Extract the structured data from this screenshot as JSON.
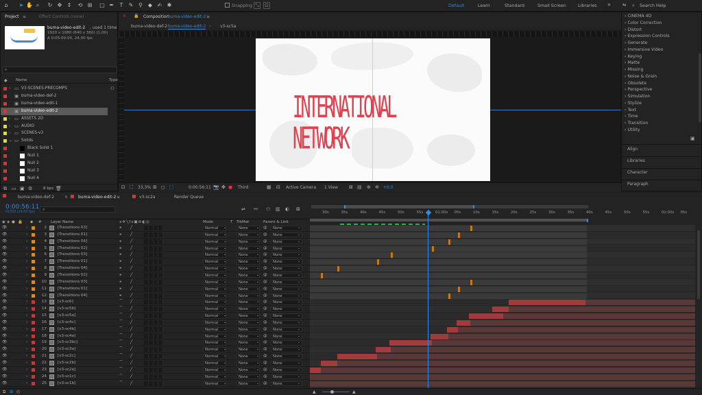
{
  "toolbar": {
    "snapping": "Snapping",
    "workspaces": [
      "Default",
      "Learn",
      "Standard",
      "Small Screen",
      "Libraries"
    ],
    "search": "Search Help",
    "overflow": "»"
  },
  "project": {
    "tab": "Project",
    "effects_tab": "Effect Controls (none)",
    "thumb_title": "buma-video-edit-2",
    "thumb_used": ", used 1 time",
    "thumb_res": "1920 x 1080 (640 x 360) (1,00)",
    "thumb_dur": "Δ 0:05:00:00, 24,00 fps",
    "col_name": "Name",
    "col_type": "Type",
    "items": [
      {
        "name": "V3-SCENES-PRECOMPS",
        "color": "#d33",
        "folder": true
      },
      {
        "name": "buma-video-def-2",
        "color": "#d33",
        "folder": false
      },
      {
        "name": "buma-video-edit-1",
        "color": "#d33",
        "folder": false
      },
      {
        "name": "buma-video-edit-2",
        "color": "#d33",
        "folder": false,
        "selected": true
      },
      {
        "name": "ASSETS 2D",
        "color": "#dd3",
        "folder": true
      },
      {
        "name": "AUDIO",
        "color": "#dd3",
        "folder": true
      },
      {
        "name": "SCENES-v3",
        "color": "#dd3",
        "folder": true
      },
      {
        "name": "Solids",
        "color": "#dd3",
        "folder": true,
        "open": true
      },
      {
        "name": "Black Solid 1",
        "color": "#d33",
        "folder": false,
        "swatch": "#000"
      },
      {
        "name": "Null 1",
        "color": "#d33",
        "folder": false,
        "swatch": "#fff"
      },
      {
        "name": "Null 2",
        "color": "#d33",
        "folder": false,
        "swatch": "#fff"
      },
      {
        "name": "Null 3",
        "color": "#d33",
        "folder": false,
        "swatch": "#fff"
      },
      {
        "name": "Null 4",
        "color": "#d33",
        "folder": false,
        "swatch": "#fff"
      }
    ],
    "bpc": "8 bpc"
  },
  "composition": {
    "label": "Composition",
    "name": "buma-video-edit-2",
    "tabs": [
      "buma-video-def-2",
      "buma-video-edit-2",
      "v3-sc5a"
    ],
    "headline": "INTERNATIONAL NETWORK",
    "zoom": "33,3%",
    "timecode": "0:00:56:11",
    "quality": "Third",
    "camera": "Active Camera",
    "views": "1 View",
    "exposure": "+0,0"
  },
  "effects": {
    "items": [
      "CINEMA 4D",
      "Color Correction",
      "Distort",
      "Expression Controls",
      "Generate",
      "Immersive Video",
      "Keying",
      "Matte",
      "Missing",
      "Noise & Grain",
      "Obsolete",
      "Perspective",
      "Simulation",
      "Stylize",
      "Text",
      "Time",
      "Transition",
      "Utility"
    ],
    "sections": [
      "Align",
      "Libraries",
      "Character",
      "Paragraph"
    ]
  },
  "timeline": {
    "tabs": [
      "buma-video-def-2",
      "buma-video-edit-2",
      "v3-sc2a",
      "Render Queue"
    ],
    "timecode": "0:00:56:11",
    "timecode_sub": "01350 (24.00 fps)",
    "headers": {
      "layer": "Layer Name",
      "mode": "Mode",
      "t": "T",
      "trkmat": "TrkMat",
      "parent": "Parent & Link"
    },
    "ticks": [
      "30s",
      "35s",
      "40s",
      "45s",
      "50s",
      "55s",
      "01:00s",
      "05s",
      "10s",
      "15s",
      "20s",
      "25s",
      "30s",
      "35s",
      "40s",
      "45s",
      "50s",
      "55s",
      "02:00s",
      "05s"
    ],
    "layers": [
      {
        "n": "2",
        "name": "[Transitions 03]",
        "c": "#e08a1e"
      },
      {
        "n": "3",
        "name": "[Transitions 01]",
        "c": "#e08a1e"
      },
      {
        "n": "4",
        "name": "[Transitions 04]",
        "c": "#e08a1e"
      },
      {
        "n": "5",
        "name": "[Transitions 02]",
        "c": "#e08a1e"
      },
      {
        "n": "6",
        "name": "[Transitions 03]",
        "c": "#e08a1e"
      },
      {
        "n": "7",
        "name": "[Transitions 01]",
        "c": "#e08a1e"
      },
      {
        "n": "8",
        "name": "[Transitions 04]",
        "c": "#e08a1e"
      },
      {
        "n": "9",
        "name": "[Transitions 02]",
        "c": "#e08a1e"
      },
      {
        "n": "10",
        "name": "[Transitions 03]",
        "c": "#e08a1e"
      },
      {
        "n": "11",
        "name": "[Transitions 01]",
        "c": "#e08a1e"
      },
      {
        "n": "12",
        "name": "[Transitions 04]",
        "c": "#e08a1e"
      },
      {
        "n": "13",
        "name": "[v3-sc6]",
        "c": "#c03a3a"
      },
      {
        "n": "14",
        "name": "[v3-sc5b]",
        "c": "#c03a3a"
      },
      {
        "n": "15",
        "name": "[v3-sc5a]",
        "c": "#c03a3a"
      },
      {
        "n": "16",
        "name": "[v3-sc4c]",
        "c": "#c03a3a"
      },
      {
        "n": "17",
        "name": "[v3-sc4b]",
        "c": "#c03a3a"
      },
      {
        "n": "18",
        "name": "[v3-sc4a]",
        "c": "#c03a3a"
      },
      {
        "n": "19",
        "name": "[v3-sc3bc]",
        "c": "#c03a3a"
      },
      {
        "n": "20",
        "name": "[v3-sc3a]",
        "c": "#c03a3a"
      },
      {
        "n": "21",
        "name": "[v3-sc2c]",
        "c": "#c03a3a"
      },
      {
        "n": "22",
        "name": "[v3-sc2b]",
        "c": "#c03a3a"
      },
      {
        "n": "23",
        "name": "[v3-sc2a]",
        "c": "#c03a3a"
      },
      {
        "n": "24",
        "name": "[v3-sc1c]",
        "c": "#c03a3a"
      },
      {
        "n": "25",
        "name": "[v3-sc1b]",
        "c": "#c03a3a"
      }
    ],
    "mode_label": "Normal",
    "none_label": "None"
  }
}
